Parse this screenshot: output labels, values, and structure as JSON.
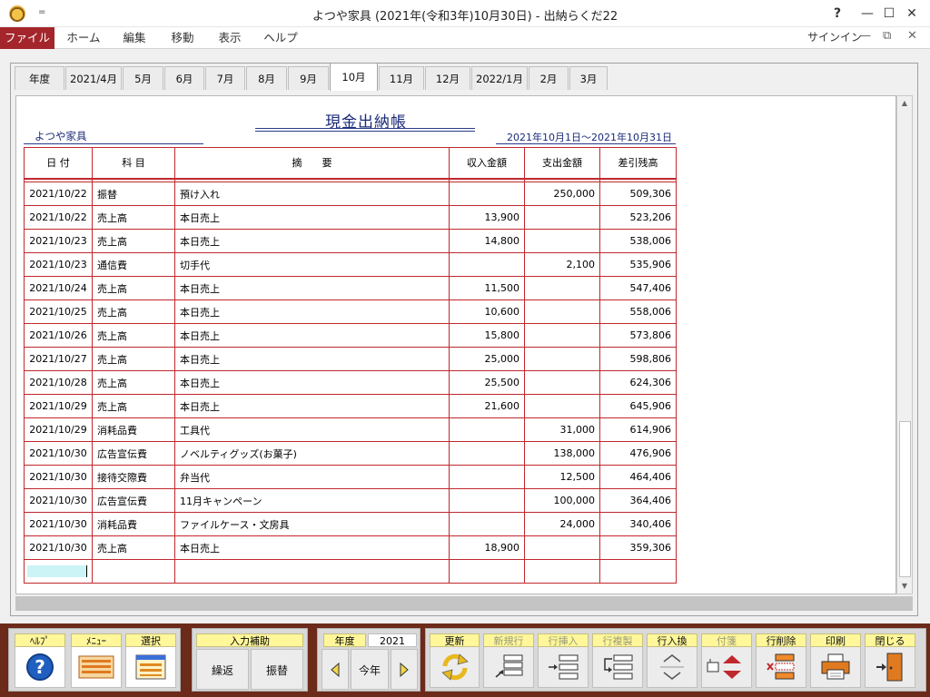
{
  "window": {
    "title": "よつや家具 (2021年(令和3年)10月30日) - 出納らくだ22",
    "qa_glyph": "=",
    "help": "?",
    "minimize": "—",
    "maximize": "☐",
    "close": "✕"
  },
  "ribbon": {
    "tabs": [
      "ファイル",
      "ホーム",
      "編集",
      "移動",
      "表示",
      "ヘルプ"
    ],
    "signin": "サインイン",
    "ribbon_min": "—",
    "ribbon_restore": "⧉",
    "ribbon_close": "✕"
  },
  "month_tabs": [
    "年度",
    "2021/4月",
    "5月",
    "6月",
    "7月",
    "8月",
    "9月",
    "10月",
    "11月",
    "12月",
    "2022/1月",
    "2月",
    "3月"
  ],
  "active_tab_index": 7,
  "ledger": {
    "title": "現金出納帳",
    "company": "よつや家具",
    "period": "2021年10月1日～2021年10月31日",
    "headers": {
      "date": "日 付",
      "subject": "科 目",
      "description": "摘　　要",
      "income": "収入金額",
      "expense": "支出金額",
      "balance": "差引残高"
    },
    "rows": [
      {
        "date": "2021/10/22",
        "subject": "振替",
        "description": "預け入れ",
        "income": "",
        "expense": "250,000",
        "balance": "509,306"
      },
      {
        "date": "2021/10/22",
        "subject": "売上高",
        "description": "本日売上",
        "income": "13,900",
        "expense": "",
        "balance": "523,206"
      },
      {
        "date": "2021/10/23",
        "subject": "売上高",
        "description": "本日売上",
        "income": "14,800",
        "expense": "",
        "balance": "538,006"
      },
      {
        "date": "2021/10/23",
        "subject": "通信費",
        "description": "切手代",
        "income": "",
        "expense": "2,100",
        "balance": "535,906"
      },
      {
        "date": "2021/10/24",
        "subject": "売上高",
        "description": "本日売上",
        "income": "11,500",
        "expense": "",
        "balance": "547,406"
      },
      {
        "date": "2021/10/25",
        "subject": "売上高",
        "description": "本日売上",
        "income": "10,600",
        "expense": "",
        "balance": "558,006"
      },
      {
        "date": "2021/10/26",
        "subject": "売上高",
        "description": "本日売上",
        "income": "15,800",
        "expense": "",
        "balance": "573,806"
      },
      {
        "date": "2021/10/27",
        "subject": "売上高",
        "description": "本日売上",
        "income": "25,000",
        "expense": "",
        "balance": "598,806"
      },
      {
        "date": "2021/10/28",
        "subject": "売上高",
        "description": "本日売上",
        "income": "25,500",
        "expense": "",
        "balance": "624,306"
      },
      {
        "date": "2021/10/29",
        "subject": "売上高",
        "description": "本日売上",
        "income": "21,600",
        "expense": "",
        "balance": "645,906"
      },
      {
        "date": "2021/10/29",
        "subject": "消耗品費",
        "description": "工具代",
        "income": "",
        "expense": "31,000",
        "balance": "614,906"
      },
      {
        "date": "2021/10/30",
        "subject": "広告宣伝費",
        "description": "ノベルティグッズ(お菓子)",
        "income": "",
        "expense": "138,000",
        "balance": "476,906"
      },
      {
        "date": "2021/10/30",
        "subject": "接待交際費",
        "description": "弁当代",
        "income": "",
        "expense": "12,500",
        "balance": "464,406"
      },
      {
        "date": "2021/10/30",
        "subject": "広告宣伝費",
        "description": "11月キャンペーン",
        "income": "",
        "expense": "100,000",
        "balance": "364,406"
      },
      {
        "date": "2021/10/30",
        "subject": "消耗品費",
        "description": "ファイルケース・文房具",
        "income": "",
        "expense": "24,000",
        "balance": "340,406"
      },
      {
        "date": "2021/10/30",
        "subject": "売上高",
        "description": "本日売上",
        "income": "18,900",
        "expense": "",
        "balance": "359,306"
      }
    ]
  },
  "toolbar": {
    "help": "ﾍﾙﾌﾟ",
    "menu": "ﾒﾆｭｰ",
    "select": "選択",
    "input_assist": "入力補助",
    "repeat": "繰返",
    "transfer": "振替",
    "year_label": "年度",
    "year_value": "2021",
    "this_year": "今年",
    "update": "更新",
    "new_row": "新規行",
    "insert_row": "行挿入",
    "copy_row": "行複製",
    "swap_row": "行入換",
    "tag": "付箋",
    "delete_row": "行削除",
    "print": "印刷",
    "close": "閉じる"
  }
}
